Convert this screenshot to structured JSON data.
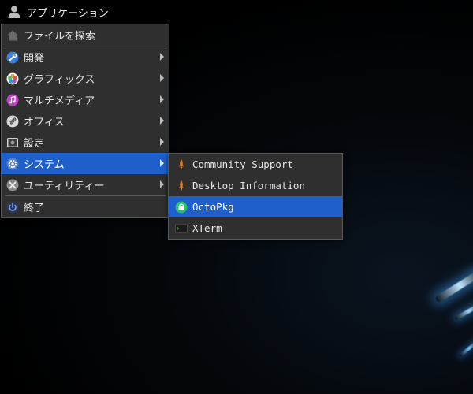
{
  "panel": {
    "app_menu_label": "アプリケーション"
  },
  "main_menu": {
    "search_label": "ファイルを探索",
    "items": [
      {
        "label": "開発",
        "icon": "wrench-icon"
      },
      {
        "label": "グラフィックス",
        "icon": "color-wheel-icon"
      },
      {
        "label": "マルチメディア",
        "icon": "music-note-icon"
      },
      {
        "label": "オフィス",
        "icon": "paperclip-icon"
      },
      {
        "label": "設定",
        "icon": "settings-panel-icon"
      },
      {
        "label": "システム",
        "icon": "system-gear-icon"
      },
      {
        "label": "ユーティリティー",
        "icon": "tools-icon"
      }
    ],
    "exit_label": "終了"
  },
  "sub_menu": {
    "items": [
      {
        "label": "Community Support",
        "icon": "rocket-icon"
      },
      {
        "label": "Desktop Information",
        "icon": "rocket-icon"
      },
      {
        "label": "OctoPkg",
        "icon": "octopkg-icon"
      },
      {
        "label": "XTerm",
        "icon": "terminal-icon"
      }
    ]
  },
  "colors": {
    "highlight": "#1f5fcc",
    "menu_bg": "#2f2f2f",
    "text": "#e6e6e6"
  }
}
